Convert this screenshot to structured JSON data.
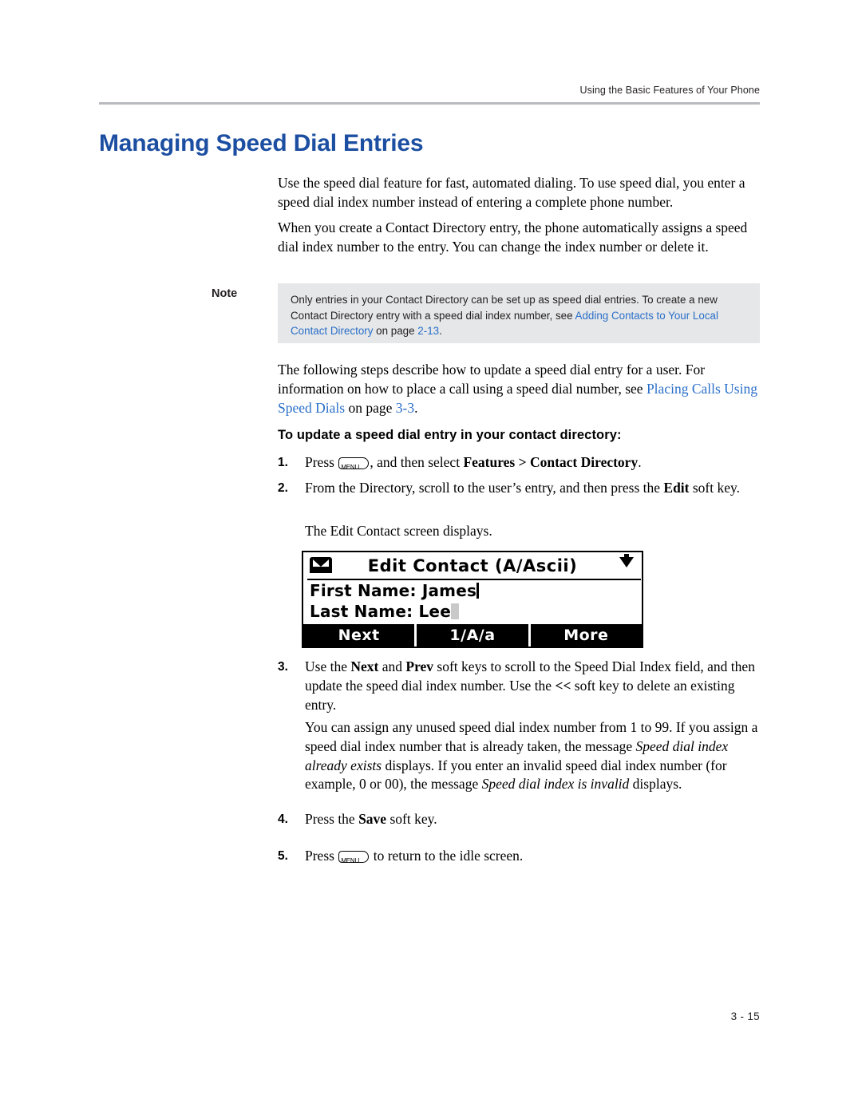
{
  "header": {
    "running_head": "Using the Basic Features of Your Phone"
  },
  "title": "Managing Speed Dial Entries",
  "paragraphs": {
    "p1": "Use the speed dial feature for fast, automated dialing. To use speed dial, you enter a speed dial index number instead of entering a complete phone number.",
    "p2": "When you create a Contact Directory entry, the phone automatically assigns a speed dial index number to the entry. You can change the index number or delete it.",
    "p3_part1": "The following steps describe how to update a speed dial entry for a user. For information on how to place a call using a speed dial number, see ",
    "p3_link": "Placing Calls Using Speed Dials",
    "p3_part2": " on page ",
    "p3_page": "3-3",
    "p3_end": "."
  },
  "note": {
    "label": "Note",
    "text_part1": "Only entries in your Contact Directory can be set up as speed dial entries. To create a new Contact Directory entry with a speed dial index number, see ",
    "link": "Adding Contacts to Your Local Contact Directory",
    "text_part2": " on page ",
    "page": "2-13",
    "text_end": "."
  },
  "subheading": "To update a speed dial entry in your contact directory:",
  "steps": [
    {
      "num": "1.",
      "pre": "Press ",
      "mid": ", and then select ",
      "bold": "Features > Contact Directory",
      "post": "."
    },
    {
      "num": "2.",
      "line1": "From the Directory, scroll to the user’s entry, and then press the ",
      "bold": "Edit",
      "line2": " soft key.",
      "follow": "The Edit Contact screen displays."
    },
    {
      "num": "3.",
      "t1": "Use the ",
      "b1": "Next",
      "t2": " and ",
      "b2": "Prev",
      "t3": " soft keys to scroll to the Speed Dial Index field, and then update the speed dial index number. Use the ",
      "b3": "<<",
      "t4": " soft key to delete an existing entry.",
      "p_a": "You can assign any unused speed dial index number from 1 to 99. If you assign a speed dial index number that is already taken, the message ",
      "p_i1": "Speed dial index already exists",
      "p_b": " displays. If you enter an invalid speed dial index number (for example, 0 or 00), the message ",
      "p_i2": "Speed dial index is invalid",
      "p_c": " displays."
    },
    {
      "num": "4.",
      "pre": "Press the ",
      "bold": "Save",
      "post": " soft key."
    },
    {
      "num": "5.",
      "pre": "Press ",
      "post": " to return to the idle screen."
    }
  ],
  "menu_key_label": "MENU",
  "lcd": {
    "title": "Edit Contact (A/Ascii)",
    "field1_label": "First Name:",
    "field1_value": "James",
    "field2_label": "Last Name:",
    "field2_value": "Lee",
    "softkeys": [
      "Next",
      "1/A/a",
      "More"
    ],
    "envelope_icon": "envelope-icon",
    "scroll_icon": "down-arrow-icon"
  },
  "footer": {
    "page_number": "3 - 15"
  },
  "colors": {
    "heading_blue": "#1c4fa1",
    "link_blue": "#2a6fc9",
    "note_bg": "#e6e7e8",
    "rule": "#b8babd"
  }
}
